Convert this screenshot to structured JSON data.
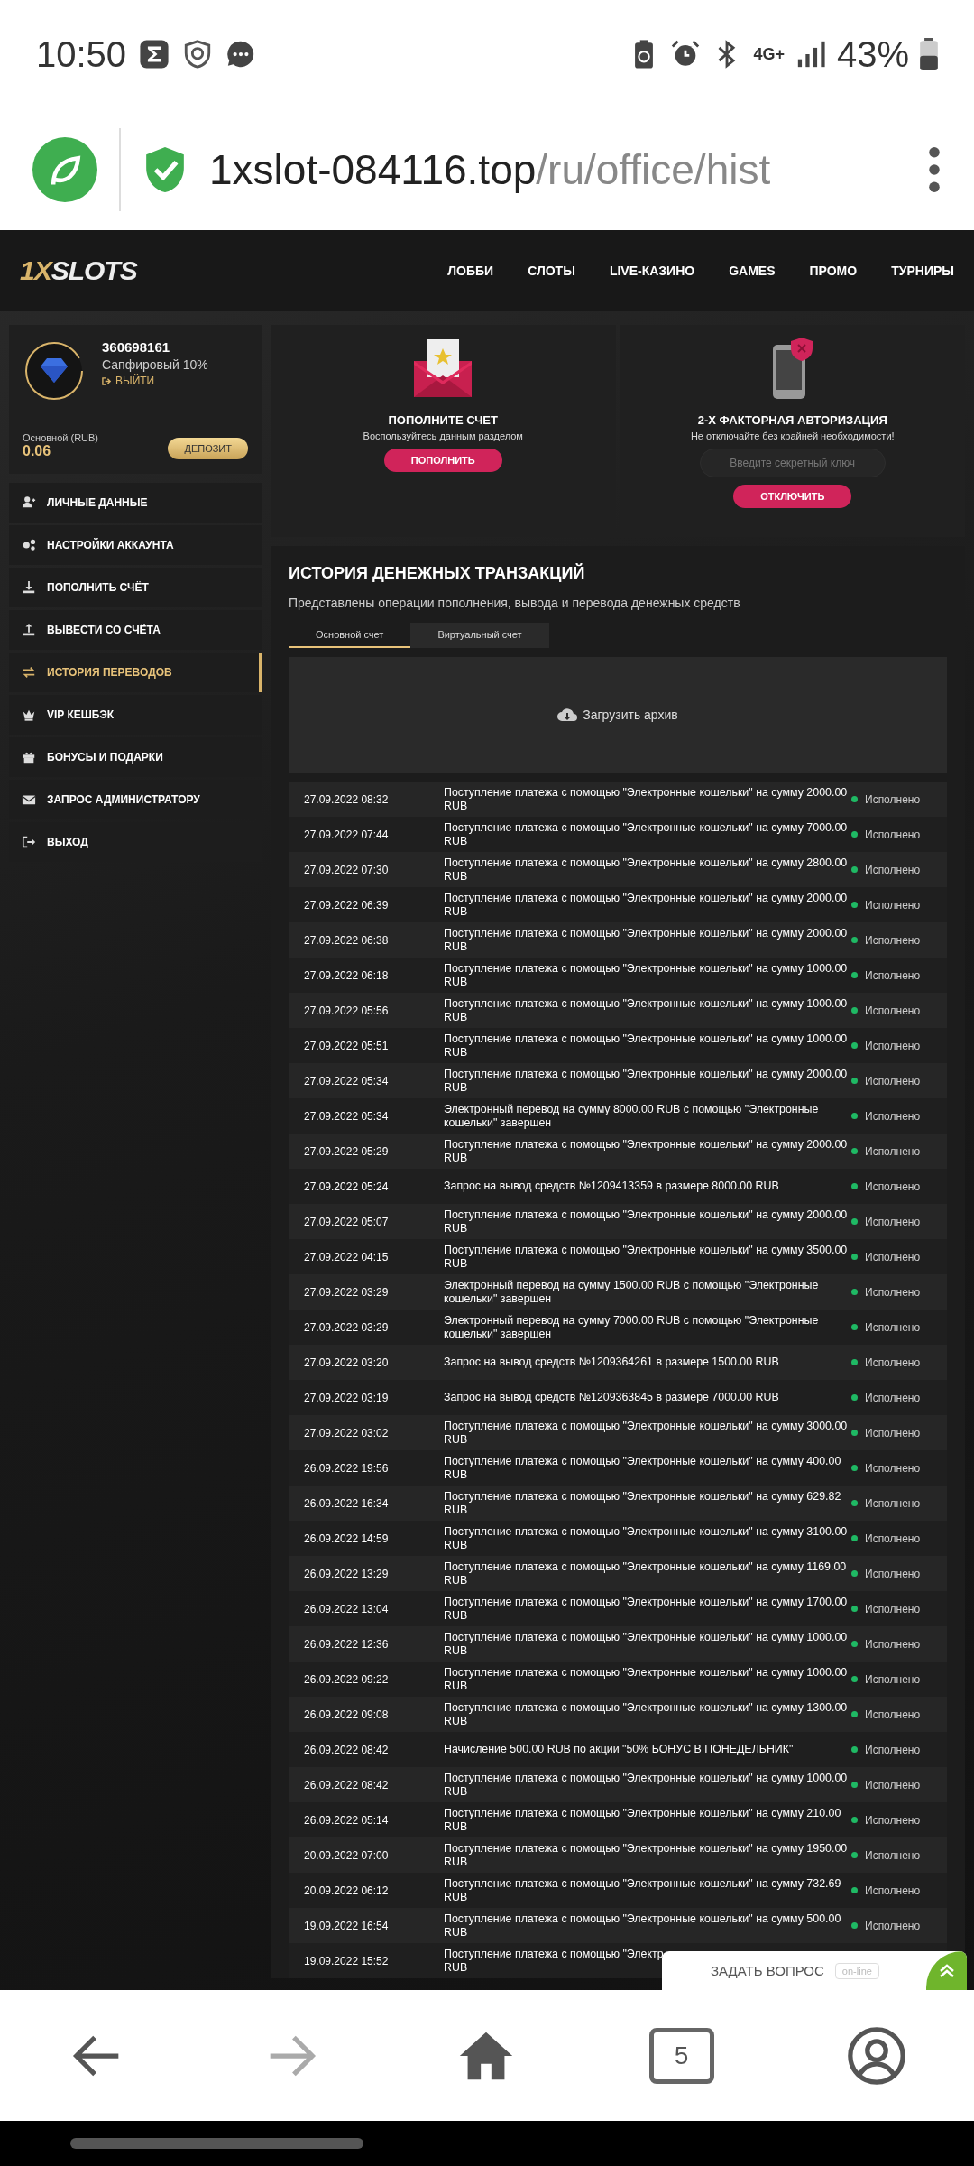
{
  "status_bar": {
    "time": "10:50",
    "network": "4G+",
    "battery": "43%"
  },
  "browser": {
    "url_host": "1xslot-084116.top",
    "url_path": "/ru/office/hist",
    "tab_count": "5"
  },
  "header": {
    "logo": {
      "mark": "1X",
      "word": "SLOTS"
    },
    "nav": [
      "ЛОББИ",
      "СЛОТЫ",
      "LIVE-КАЗИНО",
      "GAMES",
      "ПРОМО",
      "ТУРНИРЫ"
    ]
  },
  "profile": {
    "account_id": "360698161",
    "level_name": "Сапфировый 10%",
    "logout": "ВЫЙТИ",
    "balance_label": "Основной (RUB)",
    "balance": "0.06",
    "deposit_button": "ДЕПОЗИТ"
  },
  "sidebar": {
    "items": [
      {
        "label": "ЛИЧНЫЕ ДАННЫЕ",
        "selected": false
      },
      {
        "label": "НАСТРОЙКИ АККАУНТА",
        "selected": false
      },
      {
        "label": "ПОПОЛНИТЬ СЧЁТ",
        "selected": false
      },
      {
        "label": "ВЫВЕСТИ СО СЧЁТА",
        "selected": false
      },
      {
        "label": "ИСТОРИЯ ПЕРЕВОДОВ",
        "selected": true
      },
      {
        "label": "VIP КЕШБЭК",
        "selected": false
      },
      {
        "label": "БОНУСЫ И ПОДАРКИ",
        "selected": false
      },
      {
        "label": "ЗАПРОС АДМИНИСТРАТОРУ",
        "selected": false
      },
      {
        "label": "ВЫХОД",
        "selected": false
      }
    ]
  },
  "deposit_card": {
    "title": "ПОПОЛНИТЕ СЧЕТ",
    "subtitle": "Воспользуйтесь данным разделом",
    "button": "ПОПОЛНИТЬ"
  },
  "twofa_card": {
    "title": "2-Х ФАКТОРНАЯ АВТОРИЗАЦИЯ",
    "subtitle": "Не отключайте без крайней необходимости!",
    "placeholder": "Введите секретный ключ",
    "button": "ОТКЛЮЧИТЬ"
  },
  "history": {
    "title": "ИСТОРИЯ ДЕНЕЖНЫХ ТРАНЗАКЦИЙ",
    "subtitle": "Представлены операции пополнения, вывода и перевода денежных средств",
    "tabs": [
      {
        "label": "Основной счет",
        "selected": true
      },
      {
        "label": "Виртуальный счет",
        "selected": false
      }
    ],
    "archive_button": "Загрузить архив",
    "rows": [
      {
        "date": "27.09.2022 08:32",
        "description": "Поступление платежа с помощью \"Электронные кошельки\" на сумму 2000.00 RUB",
        "status": "Исполнено"
      },
      {
        "date": "27.09.2022 07:44",
        "description": "Поступление платежа с помощью \"Электронные кошельки\" на сумму 7000.00 RUB",
        "status": "Исполнено"
      },
      {
        "date": "27.09.2022 07:30",
        "description": "Поступление платежа с помощью \"Электронные кошельки\" на сумму 2800.00 RUB",
        "status": "Исполнено"
      },
      {
        "date": "27.09.2022 06:39",
        "description": "Поступление платежа с помощью \"Электронные кошельки\" на сумму 2000.00 RUB",
        "status": "Исполнено"
      },
      {
        "date": "27.09.2022 06:38",
        "description": "Поступление платежа с помощью \"Электронные кошельки\" на сумму 2000.00 RUB",
        "status": "Исполнено"
      },
      {
        "date": "27.09.2022 06:18",
        "description": "Поступление платежа с помощью \"Электронные кошельки\" на сумму 1000.00 RUB",
        "status": "Исполнено"
      },
      {
        "date": "27.09.2022 05:56",
        "description": "Поступление платежа с помощью \"Электронные кошельки\" на сумму 1000.00 RUB",
        "status": "Исполнено"
      },
      {
        "date": "27.09.2022 05:51",
        "description": "Поступление платежа с помощью \"Электронные кошельки\" на сумму 1000.00 RUB",
        "status": "Исполнено"
      },
      {
        "date": "27.09.2022 05:34",
        "description": "Поступление платежа с помощью \"Электронные кошельки\" на сумму 2000.00 RUB",
        "status": "Исполнено"
      },
      {
        "date": "27.09.2022 05:34",
        "description": "Электронный перевод на сумму 8000.00 RUB с помощью \"Электронные кошельки\" завершен",
        "status": "Исполнено"
      },
      {
        "date": "27.09.2022 05:29",
        "description": "Поступление платежа с помощью \"Электронные кошельки\" на сумму 2000.00 RUB",
        "status": "Исполнено"
      },
      {
        "date": "27.09.2022 05:24",
        "description": "Запрос на вывод средств №1209413359 в размере 8000.00 RUB",
        "status": "Исполнено"
      },
      {
        "date": "27.09.2022 05:07",
        "description": "Поступление платежа с помощью \"Электронные кошельки\" на сумму 2000.00 RUB",
        "status": "Исполнено"
      },
      {
        "date": "27.09.2022 04:15",
        "description": "Поступление платежа с помощью \"Электронные кошельки\" на сумму 3500.00 RUB",
        "status": "Исполнено"
      },
      {
        "date": "27.09.2022 03:29",
        "description": "Электронный перевод на сумму 1500.00 RUB с помощью \"Электронные кошельки\" завершен",
        "status": "Исполнено"
      },
      {
        "date": "27.09.2022 03:29",
        "description": "Электронный перевод на сумму 7000.00 RUB с помощью \"Электронные кошельки\" завершен",
        "status": "Исполнено"
      },
      {
        "date": "27.09.2022 03:20",
        "description": "Запрос на вывод средств №1209364261 в размере 1500.00 RUB",
        "status": "Исполнено"
      },
      {
        "date": "27.09.2022 03:19",
        "description": "Запрос на вывод средств №1209363845 в размере 7000.00 RUB",
        "status": "Исполнено"
      },
      {
        "date": "27.09.2022 03:02",
        "description": "Поступление платежа с помощью \"Электронные кошельки\" на сумму 3000.00 RUB",
        "status": "Исполнено"
      },
      {
        "date": "26.09.2022 19:56",
        "description": "Поступление платежа с помощью \"Электронные кошельки\" на сумму 400.00 RUB",
        "status": "Исполнено"
      },
      {
        "date": "26.09.2022 16:34",
        "description": "Поступление платежа с помощью \"Электронные кошельки\" на сумму 629.82 RUB",
        "status": "Исполнено"
      },
      {
        "date": "26.09.2022 14:59",
        "description": "Поступление платежа с помощью \"Электронные кошельки\" на сумму 3100.00 RUB",
        "status": "Исполнено"
      },
      {
        "date": "26.09.2022 13:29",
        "description": "Поступление платежа с помощью \"Электронные кошельки\" на сумму 1169.00 RUB",
        "status": "Исполнено"
      },
      {
        "date": "26.09.2022 13:04",
        "description": "Поступление платежа с помощью \"Электронные кошельки\" на сумму 1700.00 RUB",
        "status": "Исполнено"
      },
      {
        "date": "26.09.2022 12:36",
        "description": "Поступление платежа с помощью \"Электронные кошельки\" на сумму 1000.00 RUB",
        "status": "Исполнено"
      },
      {
        "date": "26.09.2022 09:22",
        "description": "Поступление платежа с помощью \"Электронные кошельки\" на сумму 1000.00 RUB",
        "status": "Исполнено"
      },
      {
        "date": "26.09.2022 09:08",
        "description": "Поступление платежа с помощью \"Электронные кошельки\" на сумму 1300.00 RUB",
        "status": "Исполнено"
      },
      {
        "date": "26.09.2022 08:42",
        "description": "Начисление 500.00 RUB по акции \"50% БОНУС В ПОНЕДЕЛЬНИК\"",
        "status": "Исполнено"
      },
      {
        "date": "26.09.2022 08:42",
        "description": "Поступление платежа с помощью \"Электронные кошельки\" на сумму 1000.00 RUB",
        "status": "Исполнено"
      },
      {
        "date": "26.09.2022 05:14",
        "description": "Поступление платежа с помощью \"Электронные кошельки\" на сумму 210.00 RUB",
        "status": "Исполнено"
      },
      {
        "date": "20.09.2022 07:00",
        "description": "Поступление платежа с помощью \"Электронные кошельки\" на сумму 1950.00 RUB",
        "status": "Исполнено"
      },
      {
        "date": "20.09.2022 06:12",
        "description": "Поступление платежа с помощью \"Электронные кошельки\" на сумму 732.69 RUB",
        "status": "Исполнено"
      },
      {
        "date": "19.09.2022 16:54",
        "description": "Поступление платежа с помощью \"Электронные кошельки\" на сумму 500.00 RUB",
        "status": "Исполнено"
      },
      {
        "date": "19.09.2022 15:52",
        "description": "Поступление платежа с помощью \"Электр",
        "description_end": "RUB"
      }
    ]
  },
  "chat_widget": {
    "label": "ЗАДАТЬ ВОПРОС",
    "badge": "on-line"
  }
}
